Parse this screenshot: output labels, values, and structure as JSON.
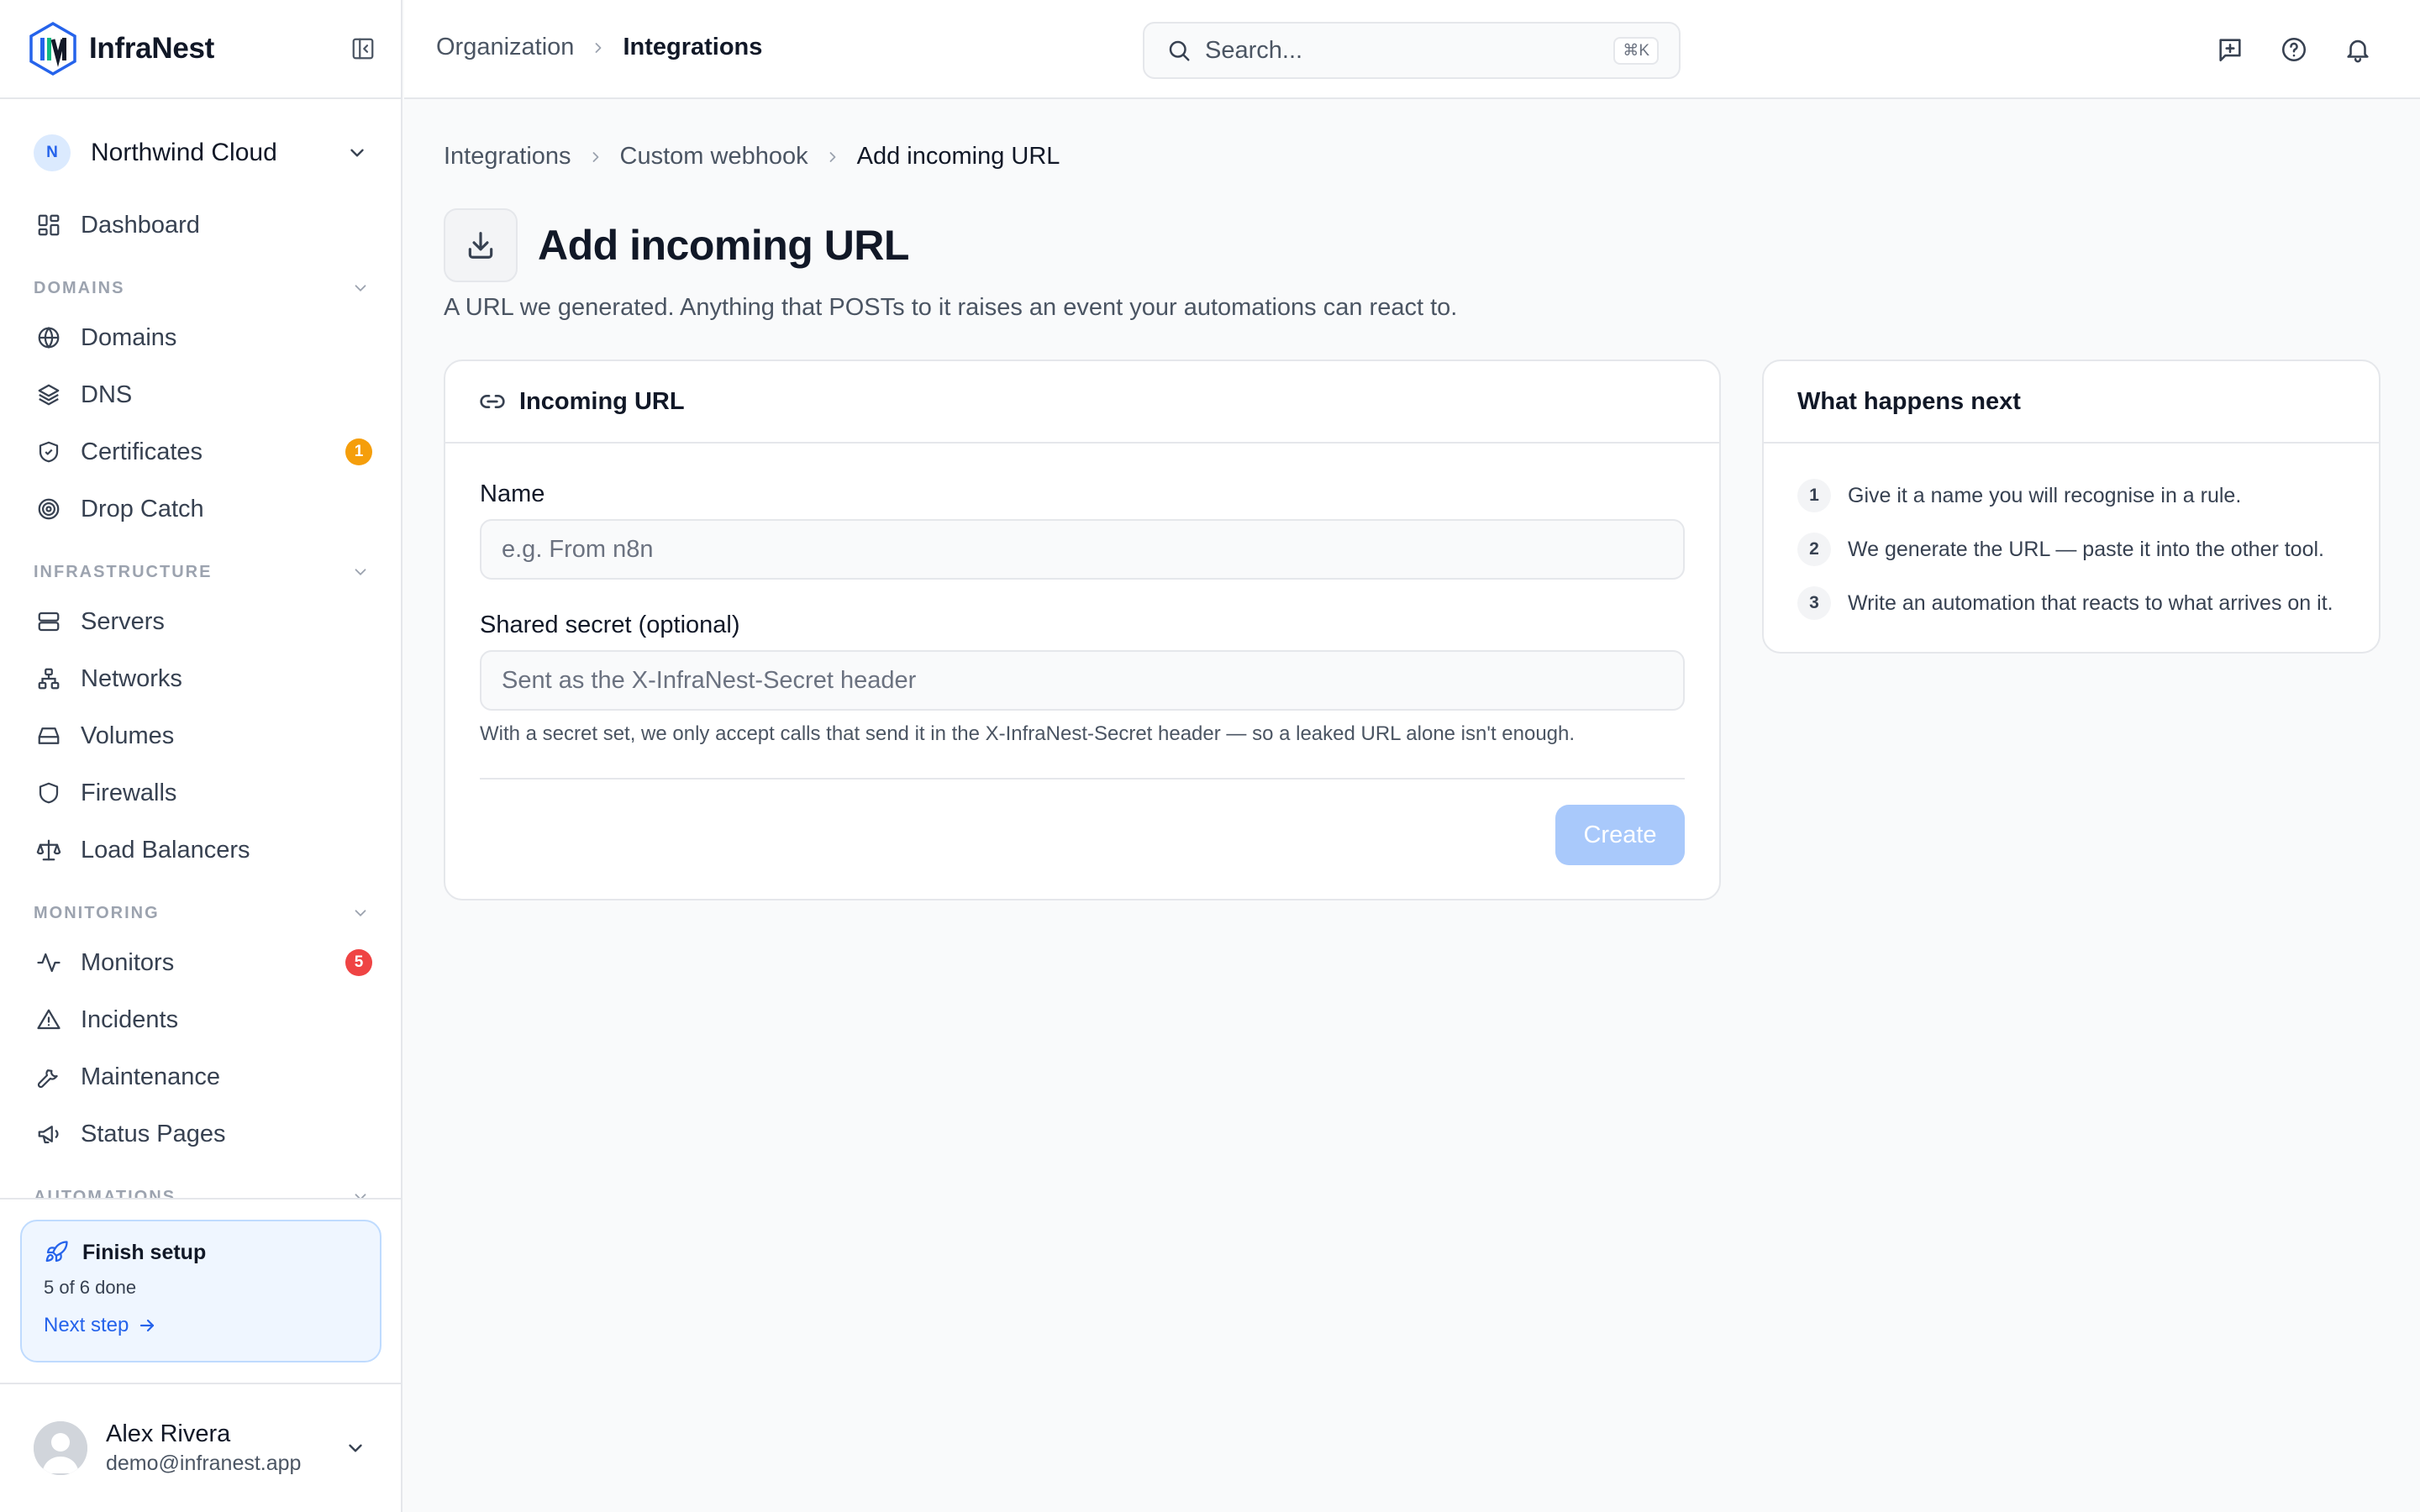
{
  "brand": {
    "name": "InfraNest"
  },
  "org": {
    "initial": "N",
    "name": "Northwind Cloud"
  },
  "sidebar": {
    "dashboard": "Dashboard",
    "sections": [
      {
        "title": "DOMAINS"
      },
      {
        "title": "INFRASTRUCTURE"
      },
      {
        "title": "MONITORING"
      },
      {
        "title": "AUTOMATIONS"
      }
    ],
    "domains": [
      {
        "label": "Domains",
        "icon": "globe-icon"
      },
      {
        "label": "DNS",
        "icon": "layers-icon"
      },
      {
        "label": "Certificates",
        "icon": "shield-check-icon",
        "badge": "1"
      },
      {
        "label": "Drop Catch",
        "icon": "target-icon"
      }
    ],
    "infrastructure": [
      {
        "label": "Servers",
        "icon": "server-icon"
      },
      {
        "label": "Networks",
        "icon": "network-icon"
      },
      {
        "label": "Volumes",
        "icon": "hard-drive-icon"
      },
      {
        "label": "Firewalls",
        "icon": "shield-icon"
      },
      {
        "label": "Load Balancers",
        "icon": "scale-icon"
      }
    ],
    "monitoring": [
      {
        "label": "Monitors",
        "icon": "activity-icon",
        "badge": "5"
      },
      {
        "label": "Incidents",
        "icon": "alert-triangle-icon"
      },
      {
        "label": "Maintenance",
        "icon": "wrench-icon"
      },
      {
        "label": "Status Pages",
        "icon": "megaphone-icon"
      }
    ],
    "colors": {
      "badge_orange": "#f59e0b",
      "badge_red": "#ef4444"
    }
  },
  "setup": {
    "title": "Finish setup",
    "progress": "5 of 6 done",
    "next": "Next step"
  },
  "user": {
    "name": "Alex Rivera",
    "email": "demo@infranest.app"
  },
  "topbar": {
    "crumb_parent": "Organization",
    "crumb_current": "Integrations",
    "search_placeholder": "Search...",
    "search_shortcut": "⌘K"
  },
  "breadcrumb": [
    "Integrations",
    "Custom webhook",
    "Add incoming URL"
  ],
  "page": {
    "title": "Add incoming URL",
    "description": "A URL we generated. Anything that POSTs to it raises an event your automations can react to."
  },
  "form": {
    "card_title": "Incoming URL",
    "name_label": "Name",
    "name_placeholder": "e.g. From n8n",
    "secret_label": "Shared secret (optional)",
    "secret_placeholder": "Sent as the X-InfraNest-Secret header",
    "secret_hint": "With a secret set, we only accept calls that send it in the X-InfraNest-Secret header — so a leaked URL alone isn't enough.",
    "create_label": "Create"
  },
  "next_steps": {
    "title": "What happens next",
    "items": [
      {
        "num": "1",
        "text": "Give it a name you will recognise in a rule."
      },
      {
        "num": "2",
        "text": "We generate the URL — paste it into the other tool."
      },
      {
        "num": "3",
        "text": "Write an automation that reacts to what arrives on it."
      }
    ]
  }
}
